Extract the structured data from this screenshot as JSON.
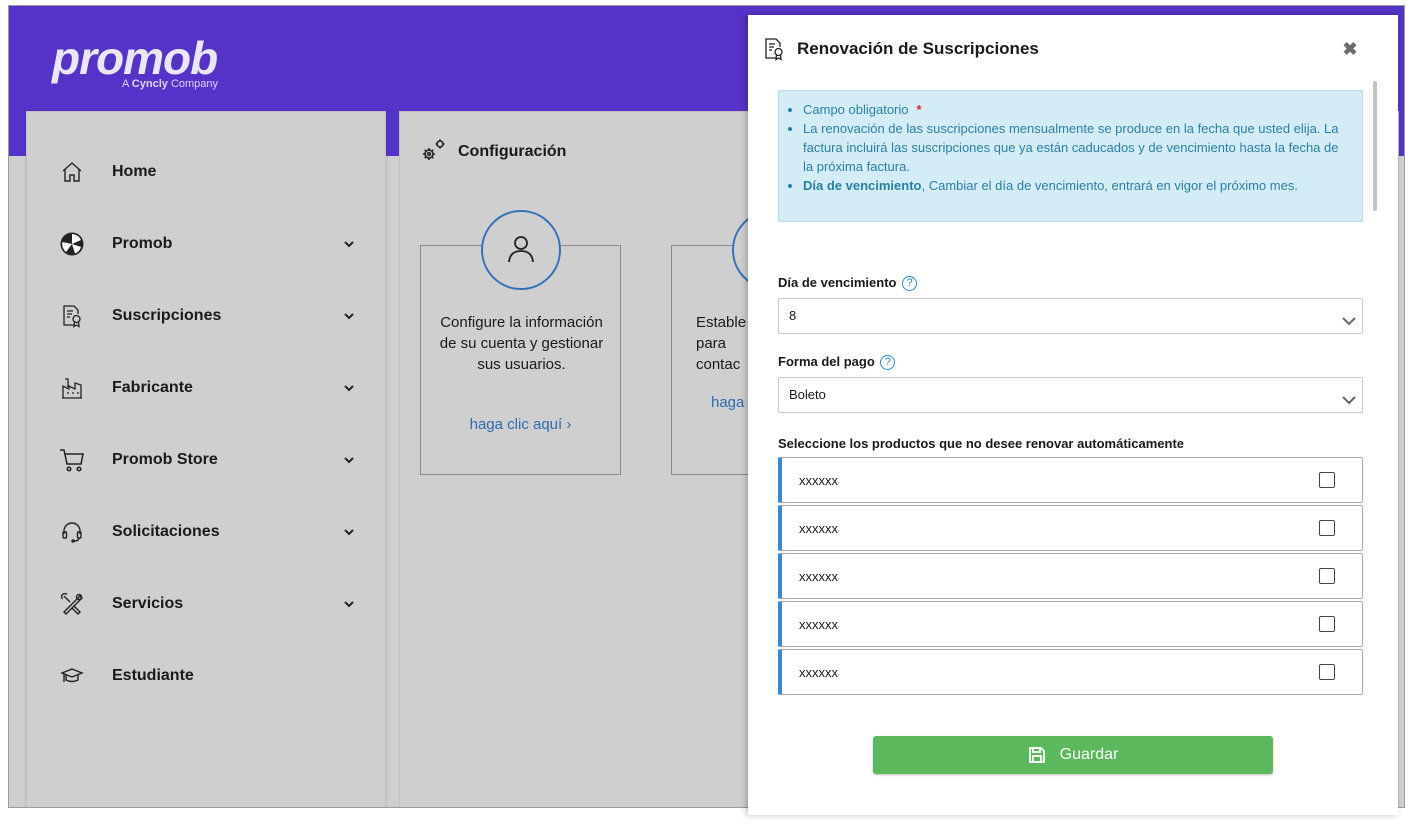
{
  "brand": {
    "logo": "promob",
    "tagline_prefix": "A",
    "tagline_brand": "Cyncly",
    "tagline_suffix": "Company",
    "primary_color": "#5533c9"
  },
  "sidebar": {
    "items": [
      {
        "label": "Home",
        "icon": "home-icon",
        "has_submenu": false
      },
      {
        "label": "Promob",
        "icon": "promob-logo-icon",
        "has_submenu": true
      },
      {
        "label": "Suscripciones",
        "icon": "subscription-document-icon",
        "has_submenu": true
      },
      {
        "label": "Fabricante",
        "icon": "factory-icon",
        "has_submenu": true
      },
      {
        "label": "Promob Store",
        "icon": "shopping-cart-icon",
        "has_submenu": true
      },
      {
        "label": "Solicitaciones",
        "icon": "headset-icon",
        "has_submenu": true
      },
      {
        "label": "Servicios",
        "icon": "tools-icon",
        "has_submenu": true
      },
      {
        "label": "Estudiante",
        "icon": "graduation-cap-icon",
        "has_submenu": false
      }
    ]
  },
  "content": {
    "title": "Configuración",
    "title_icon": "gears-icon",
    "cards": [
      {
        "text": "Configure la información de su cuenta y gestionar sus usuarios.",
        "link": "haga clic aquí",
        "icon": "user-icon"
      },
      {
        "text": "Estable para contac",
        "link": "haga",
        "icon": "partial-icon"
      }
    ]
  },
  "modal": {
    "title": "Renovación de Suscripciones",
    "title_icon": "subscription-document-icon",
    "close_icon": "close-icon",
    "info": {
      "required_label": "Campo obligatorio",
      "required_mark": "*",
      "line2": "La renovación de las suscripciones mensualmente se produce en la fecha que usted elija. La factura incluirá las suscripciones que ya están caducados y de vencimiento hasta la fecha de la próxima factura.",
      "line3_bold": "Día de vencimiento",
      "line3_rest": ", Cambiar el día de vencimiento, entrará en vigor el próximo mes."
    },
    "due_day": {
      "label": "Día de vencimiento",
      "help": "?",
      "value": "8"
    },
    "payment": {
      "label": "Forma del pago",
      "help": "?",
      "value": "Boleto"
    },
    "products_label": "Seleccione los productos que no desee renovar automáticamente",
    "products": [
      {
        "name": "xxxxxx",
        "checked": false
      },
      {
        "name": "xxxxxx",
        "checked": false
      },
      {
        "name": "xxxxxx",
        "checked": false
      },
      {
        "name": "xxxxxx",
        "checked": false
      },
      {
        "name": "xxxxxx",
        "checked": false
      },
      {
        "name": "",
        "checked": false
      }
    ],
    "save_label": "Guardar",
    "save_color": "#5cb85c"
  }
}
